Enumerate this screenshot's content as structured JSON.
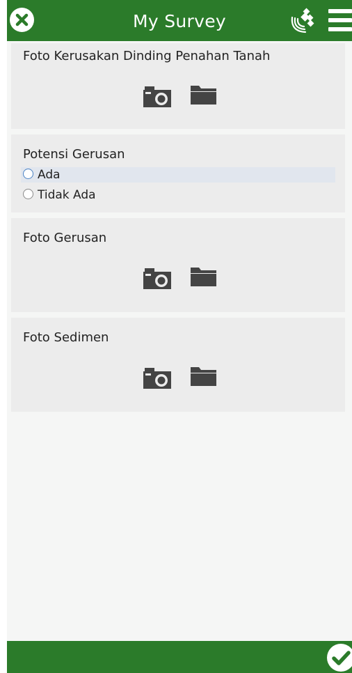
{
  "header": {
    "title": "My Survey"
  },
  "fields": [
    {
      "label": "Foto Kerusakan Dinding Penahan Tanah",
      "type": "photo"
    },
    {
      "label": "Potensi Gerusan",
      "type": "radio",
      "options": [
        {
          "label": "Ada",
          "selected": false,
          "focused": true
        },
        {
          "label": "Tidak Ada",
          "selected": false,
          "focused": false
        }
      ]
    },
    {
      "label": "Foto Gerusan",
      "type": "photo"
    },
    {
      "label": "Foto Sedimen",
      "type": "photo"
    }
  ],
  "icons": {
    "close": "close-icon",
    "gps": "satellite-gps-icon",
    "menu": "hamburger-menu-icon",
    "camera": "camera-icon",
    "folder": "folder-icon",
    "submit": "checkmark-icon"
  },
  "colors": {
    "brand": "#2b7b2a",
    "card": "#ececec",
    "background": "#f5f6f5",
    "focus_row": "#e1e6ee",
    "icon": "#444444"
  }
}
